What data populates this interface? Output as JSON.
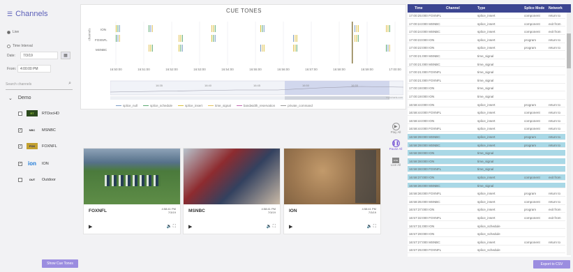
{
  "sidebar": {
    "title": "Channels",
    "radio_live": "Live",
    "radio_interval": "Time Interval",
    "date_label": "Date:",
    "date_value": "7/3/19",
    "from_label": "From:",
    "from_value": "4:00:00 PM",
    "search_placeholder": "Search channels",
    "group": "Demo",
    "channels": [
      {
        "name": "RTDocHD",
        "logo": "RT",
        "checked": false
      },
      {
        "name": "MSNBC",
        "logo": "NBC",
        "checked": true
      },
      {
        "name": "FOXNFL",
        "logo": "FOX",
        "checked": true
      },
      {
        "name": "ION",
        "logo": "ion",
        "checked": true
      },
      {
        "name": "Outdoor",
        "logo": "OUT",
        "checked": false
      }
    ],
    "show_button": "Show Cue Tones"
  },
  "cue": {
    "title": "CUE TONES",
    "y_label": "channels",
    "rows": [
      "ION",
      "FOXNFL",
      "MSNBC"
    ],
    "x_ticks": [
      "16:50:00",
      "16:51:00",
      "16:52:00",
      "16:53:00",
      "16:54:00",
      "16:55:00",
      "16:56:00",
      "16:57:00",
      "16:58:00",
      "16:59:00",
      "17:00:00"
    ],
    "nav_ticks": [
      "16:35",
      "16:40",
      "16:45",
      "16:50",
      "16:55"
    ],
    "nav_label": "highcharts.com",
    "legend": [
      {
        "name": "splice_null",
        "color": "#7a9cc6"
      },
      {
        "name": "splice_schedule",
        "color": "#5aa870"
      },
      {
        "name": "splice_insert",
        "color": "#d9c13b"
      },
      {
        "name": "time_signal",
        "color": "#e3c25a"
      },
      {
        "name": "bandwidth_reservation",
        "color": "#c06ab0"
      },
      {
        "name": "private_command",
        "color": "#999999"
      }
    ]
  },
  "tiles": [
    {
      "name": "FOXNFL",
      "time": "4:58:41 PM",
      "date": "7/3/19"
    },
    {
      "name": "MSNBC",
      "time": "4:58:41 PM",
      "date": "7/3/19"
    },
    {
      "name": "ION",
      "time": "4:58:41 PM",
      "date": "7/3/19"
    }
  ],
  "playback": {
    "play_all": "Play All",
    "pause_all": "Pause All",
    "live_all": "Live All",
    "live_badge": "LIVE"
  },
  "table": {
    "headers": [
      "Time",
      "Channel",
      "Type",
      "Splice Mode",
      "Network"
    ],
    "rows": [
      [
        "17:00:25:000 FOXNFL",
        "splice_insert",
        "component",
        "return to",
        false
      ],
      [
        "17:00:24:000 MSNBC",
        "splice_insert",
        "component",
        "exit from",
        false
      ],
      [
        "17:00:24:000 MSNBC",
        "splice_insert",
        "component",
        "exit from",
        false
      ],
      [
        "17:00:23:000 ION",
        "splice_insert",
        "program",
        "return to",
        false
      ],
      [
        "17:00:22:000 ION",
        "splice_insert",
        "program",
        "return to",
        false
      ],
      [
        "17:00:21:000 MSNBC",
        "time_signal",
        "",
        "",
        false
      ],
      [
        "17:00:21:000 MSNBC",
        "time_signal",
        "",
        "",
        false
      ],
      [
        "17:00:21:000 FOXNFL",
        "time_signal",
        "",
        "",
        false
      ],
      [
        "17:00:21:000 FOXNFL",
        "time_signal",
        "",
        "",
        false
      ],
      [
        "17:00:19:000 ION",
        "time_signal",
        "",
        "",
        false
      ],
      [
        "17:00:19:000 ION",
        "time_signal",
        "",
        "",
        false
      ],
      [
        "16:58:44:000 ION",
        "splice_insert",
        "program",
        "return to",
        false
      ],
      [
        "16:58:44:000 FOXNFL",
        "splice_insert",
        "component",
        "return to",
        false
      ],
      [
        "16:58:44:000 ION",
        "splice_insert",
        "component",
        "return to",
        false
      ],
      [
        "16:58:44:000 FOXNFL",
        "splice_insert",
        "component",
        "return to",
        false
      ],
      [
        "16:58:39:000 MSNBC",
        "splice_insert",
        "program",
        "return to",
        true
      ],
      [
        "16:58:39:000 MSNBC",
        "splice_insert",
        "program",
        "return to",
        true
      ],
      [
        "16:58:38:000 ION",
        "time_signal",
        "",
        "",
        true
      ],
      [
        "16:58:38:000 ION",
        "time_signal",
        "",
        "",
        true
      ],
      [
        "16:58:38:000 FOXNFL",
        "time_signal",
        "",
        "",
        true
      ],
      [
        "16:58:37:000 ION",
        "splice_insert",
        "component",
        "exit from",
        true
      ],
      [
        "16:58:36:000 MSNBC",
        "time_signal",
        "",
        "",
        true
      ],
      [
        "16:58:36:000 FOXNFL",
        "splice_insert",
        "program",
        "return to",
        false
      ],
      [
        "16:58:35:000 MSNBC",
        "splice_insert",
        "component",
        "return to",
        false
      ],
      [
        "16:57:37:000 ION",
        "splice_insert",
        "program",
        "exit from",
        false
      ],
      [
        "16:57:32:000 FOXNFL",
        "splice_insert",
        "component",
        "exit from",
        false
      ],
      [
        "16:57:31:000 ION",
        "splice_schedule",
        "",
        "",
        false
      ],
      [
        "16:57:28:000 ION",
        "splice_schedule",
        "",
        "",
        false
      ],
      [
        "16:57:27:000 MSNBC",
        "splice_insert",
        "component",
        "return to",
        false
      ],
      [
        "16:57:25:000 FOXNFL",
        "splice_schedule",
        "",
        "",
        false
      ]
    ],
    "export_button": "Export to CSV"
  }
}
